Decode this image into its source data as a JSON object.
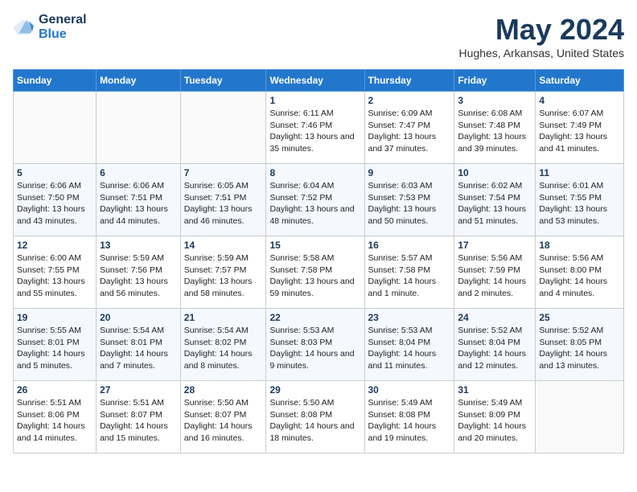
{
  "logo": {
    "general": "General",
    "blue": "Blue"
  },
  "title": "May 2024",
  "subtitle": "Hughes, Arkansas, United States",
  "days_of_week": [
    "Sunday",
    "Monday",
    "Tuesday",
    "Wednesday",
    "Thursday",
    "Friday",
    "Saturday"
  ],
  "weeks": [
    [
      {
        "day": "",
        "info": ""
      },
      {
        "day": "",
        "info": ""
      },
      {
        "day": "",
        "info": ""
      },
      {
        "day": "1",
        "info": "Sunrise: 6:11 AM\nSunset: 7:46 PM\nDaylight: 13 hours\nand 35 minutes."
      },
      {
        "day": "2",
        "info": "Sunrise: 6:09 AM\nSunset: 7:47 PM\nDaylight: 13 hours\nand 37 minutes."
      },
      {
        "day": "3",
        "info": "Sunrise: 6:08 AM\nSunset: 7:48 PM\nDaylight: 13 hours\nand 39 minutes."
      },
      {
        "day": "4",
        "info": "Sunrise: 6:07 AM\nSunset: 7:49 PM\nDaylight: 13 hours\nand 41 minutes."
      }
    ],
    [
      {
        "day": "5",
        "info": "Sunrise: 6:06 AM\nSunset: 7:50 PM\nDaylight: 13 hours\nand 43 minutes."
      },
      {
        "day": "6",
        "info": "Sunrise: 6:06 AM\nSunset: 7:51 PM\nDaylight: 13 hours\nand 44 minutes."
      },
      {
        "day": "7",
        "info": "Sunrise: 6:05 AM\nSunset: 7:51 PM\nDaylight: 13 hours\nand 46 minutes."
      },
      {
        "day": "8",
        "info": "Sunrise: 6:04 AM\nSunset: 7:52 PM\nDaylight: 13 hours\nand 48 minutes."
      },
      {
        "day": "9",
        "info": "Sunrise: 6:03 AM\nSunset: 7:53 PM\nDaylight: 13 hours\nand 50 minutes."
      },
      {
        "day": "10",
        "info": "Sunrise: 6:02 AM\nSunset: 7:54 PM\nDaylight: 13 hours\nand 51 minutes."
      },
      {
        "day": "11",
        "info": "Sunrise: 6:01 AM\nSunset: 7:55 PM\nDaylight: 13 hours\nand 53 minutes."
      }
    ],
    [
      {
        "day": "12",
        "info": "Sunrise: 6:00 AM\nSunset: 7:55 PM\nDaylight: 13 hours\nand 55 minutes."
      },
      {
        "day": "13",
        "info": "Sunrise: 5:59 AM\nSunset: 7:56 PM\nDaylight: 13 hours\nand 56 minutes."
      },
      {
        "day": "14",
        "info": "Sunrise: 5:59 AM\nSunset: 7:57 PM\nDaylight: 13 hours\nand 58 minutes."
      },
      {
        "day": "15",
        "info": "Sunrise: 5:58 AM\nSunset: 7:58 PM\nDaylight: 13 hours\nand 59 minutes."
      },
      {
        "day": "16",
        "info": "Sunrise: 5:57 AM\nSunset: 7:58 PM\nDaylight: 14 hours\nand 1 minute."
      },
      {
        "day": "17",
        "info": "Sunrise: 5:56 AM\nSunset: 7:59 PM\nDaylight: 14 hours\nand 2 minutes."
      },
      {
        "day": "18",
        "info": "Sunrise: 5:56 AM\nSunset: 8:00 PM\nDaylight: 14 hours\nand 4 minutes."
      }
    ],
    [
      {
        "day": "19",
        "info": "Sunrise: 5:55 AM\nSunset: 8:01 PM\nDaylight: 14 hours\nand 5 minutes."
      },
      {
        "day": "20",
        "info": "Sunrise: 5:54 AM\nSunset: 8:01 PM\nDaylight: 14 hours\nand 7 minutes."
      },
      {
        "day": "21",
        "info": "Sunrise: 5:54 AM\nSunset: 8:02 PM\nDaylight: 14 hours\nand 8 minutes."
      },
      {
        "day": "22",
        "info": "Sunrise: 5:53 AM\nSunset: 8:03 PM\nDaylight: 14 hours\nand 9 minutes."
      },
      {
        "day": "23",
        "info": "Sunrise: 5:53 AM\nSunset: 8:04 PM\nDaylight: 14 hours\nand 11 minutes."
      },
      {
        "day": "24",
        "info": "Sunrise: 5:52 AM\nSunset: 8:04 PM\nDaylight: 14 hours\nand 12 minutes."
      },
      {
        "day": "25",
        "info": "Sunrise: 5:52 AM\nSunset: 8:05 PM\nDaylight: 14 hours\nand 13 minutes."
      }
    ],
    [
      {
        "day": "26",
        "info": "Sunrise: 5:51 AM\nSunset: 8:06 PM\nDaylight: 14 hours\nand 14 minutes."
      },
      {
        "day": "27",
        "info": "Sunrise: 5:51 AM\nSunset: 8:07 PM\nDaylight: 14 hours\nand 15 minutes."
      },
      {
        "day": "28",
        "info": "Sunrise: 5:50 AM\nSunset: 8:07 PM\nDaylight: 14 hours\nand 16 minutes."
      },
      {
        "day": "29",
        "info": "Sunrise: 5:50 AM\nSunset: 8:08 PM\nDaylight: 14 hours\nand 18 minutes."
      },
      {
        "day": "30",
        "info": "Sunrise: 5:49 AM\nSunset: 8:08 PM\nDaylight: 14 hours\nand 19 minutes."
      },
      {
        "day": "31",
        "info": "Sunrise: 5:49 AM\nSunset: 8:09 PM\nDaylight: 14 hours\nand 20 minutes."
      },
      {
        "day": "",
        "info": ""
      }
    ]
  ]
}
